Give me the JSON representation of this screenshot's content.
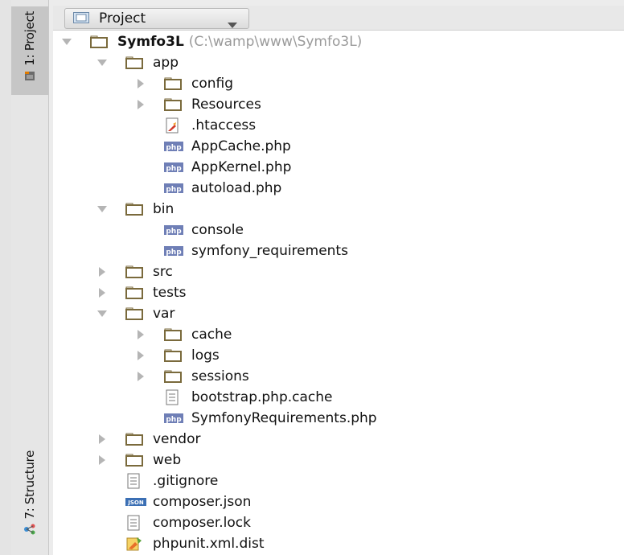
{
  "sidebar": {
    "project_tab": "1: Project",
    "structure_tab": "7: Structure"
  },
  "toolbar": {
    "view_dropdown": "Project"
  },
  "tree": {
    "root": {
      "label": "Symfo3L",
      "path": "(C:\\wamp\\www\\Symfo3L)"
    },
    "items": [
      {
        "label": "app"
      },
      {
        "label": "config"
      },
      {
        "label": "Resources"
      },
      {
        "label": ".htaccess"
      },
      {
        "label": "AppCache.php"
      },
      {
        "label": "AppKernel.php"
      },
      {
        "label": "autoload.php"
      },
      {
        "label": "bin"
      },
      {
        "label": "console"
      },
      {
        "label": "symfony_requirements"
      },
      {
        "label": "src"
      },
      {
        "label": "tests"
      },
      {
        "label": "var"
      },
      {
        "label": "cache"
      },
      {
        "label": "logs"
      },
      {
        "label": "sessions"
      },
      {
        "label": "bootstrap.php.cache"
      },
      {
        "label": "SymfonyRequirements.php"
      },
      {
        "label": "vendor"
      },
      {
        "label": "web"
      },
      {
        "label": ".gitignore"
      },
      {
        "label": "composer.json"
      },
      {
        "label": "composer.lock"
      },
      {
        "label": "phpunit.xml.dist"
      }
    ]
  },
  "icons": {
    "php_badge": "php",
    "json_badge": "JSON"
  },
  "colors": {
    "folder_outline": "#7a6a3c",
    "php_badge_bg": "#6f7fb6",
    "arrow": "#b5b5b5"
  }
}
